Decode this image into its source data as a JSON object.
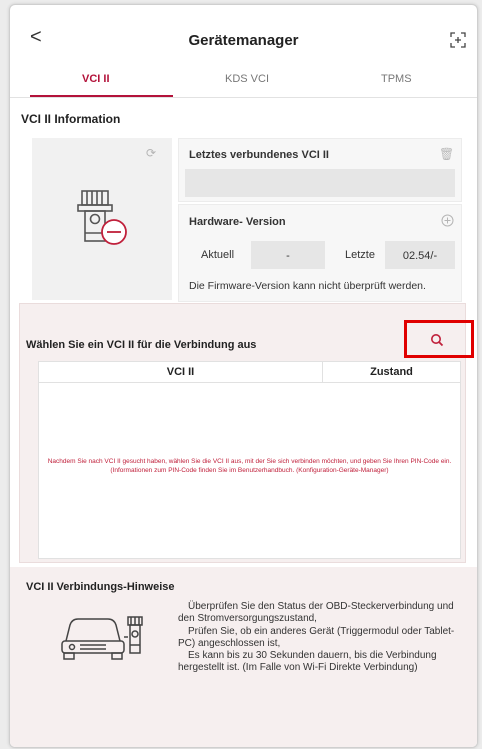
{
  "header": {
    "back_label": "<",
    "title": "Gerätemanager"
  },
  "tabs": [
    {
      "label": "VCI II",
      "active": true
    },
    {
      "label": "KDS VCI",
      "active": false
    },
    {
      "label": "TPMS",
      "active": false
    }
  ],
  "info": {
    "title": "VCI II Information",
    "last_connected": {
      "title": "Letztes verbundenes VCI II",
      "value": ""
    },
    "hardware": {
      "title": "Hardware- Version",
      "current_label": "Aktuell",
      "current_value": "-",
      "latest_label": "Letzte",
      "latest_value": "02.54/-",
      "note": "Die Firmware-Version kann nicht überprüft werden."
    }
  },
  "selection": {
    "title": "Wählen Sie ein VCI II für die Verbindung aus",
    "columns": [
      "VCI II",
      "Zustand"
    ],
    "message": "Nachdem Sie nach VCI II gesucht haben, wählen Sie die VCI II aus, mit der Sie sich verbinden möchten, und geben Sie Ihren PIN-Code ein. (Informationen zum PIN-Code finden Sie im Benutzerhandbuch. (Konfiguration-Geräte-Manager)"
  },
  "hints": {
    "title": "VCI II Verbindungs-Hinweise",
    "lines": [
      "Überprüfen Sie den Status der OBD-Steckerverbindung und den Stromversorgungszustand,",
      "Prüfen Sie, ob ein anderes Gerät (Triggermodul oder Tablet-PC) angeschlossen ist,",
      "Es kann bis zu 30 Sekunden dauern, bis die Verbindung hergestellt ist. (Im Falle von Wi-Fi Direkte Verbindung)"
    ]
  },
  "colors": {
    "accent": "#b3123a",
    "highlight": "#e00000",
    "panel": "#f6efef"
  },
  "icons": [
    "back-icon",
    "scan-icon",
    "refresh-icon",
    "trash-icon",
    "update-icon",
    "search-icon",
    "vci-device-icon",
    "car-vci-icon"
  ]
}
